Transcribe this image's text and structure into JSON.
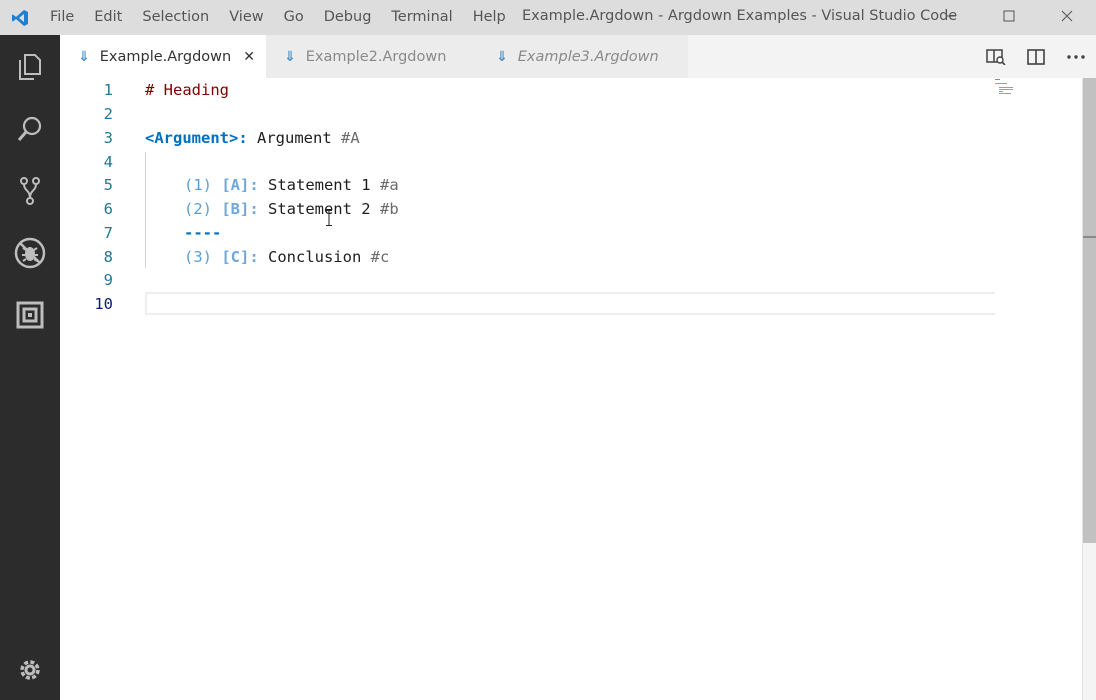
{
  "menu": [
    "File",
    "Edit",
    "Selection",
    "View",
    "Go",
    "Debug",
    "Terminal",
    "Help"
  ],
  "window_title": "Example.Argdown - Argdown Examples - Visual Studio Code",
  "window_controls": [
    "minimize-icon",
    "maximize-icon",
    "close-icon"
  ],
  "activity_bar": [
    "explorer-icon",
    "search-icon",
    "source-control-icon",
    "debug-icon",
    "extensions-icon",
    "settings-gear-icon"
  ],
  "tabs": [
    {
      "label": "Example.Argdown",
      "active": true,
      "close": "✕"
    },
    {
      "label": "Example2.Argdown",
      "active": false
    },
    {
      "label": "Example3.Argdown",
      "active": false,
      "preview": true
    }
  ],
  "tab_actions": [
    "open-preview-icon",
    "split-editor-icon",
    "more-actions-icon"
  ],
  "editor": {
    "line_numbers": [
      "1",
      "2",
      "3",
      "4",
      "5",
      "6",
      "7",
      "8",
      "9",
      "10"
    ],
    "current_line": "10",
    "lines": {
      "l1": {
        "heading": "# Heading"
      },
      "l3": {
        "argument": "<Argument>",
        "colon": ":",
        "title": " Argument ",
        "tag": "#A"
      },
      "l5": {
        "num": "(1) ",
        "ref": "[A]:",
        "text": " Statement 1 ",
        "tag": "#a"
      },
      "l6": {
        "num": "(2) ",
        "ref": "[B]:",
        "text": " Statement 2 ",
        "tag": "#b"
      },
      "l7": {
        "sep": "----"
      },
      "l8": {
        "num": "(3) ",
        "ref": "[C]:",
        "text": " Conclusion ",
        "tag": "#c"
      }
    }
  },
  "colors": {
    "titlebar": "#dddddd",
    "activitybar": "#2c2c2c",
    "line_number": "#237893",
    "argument": "#0070c1",
    "heading": "#800000"
  }
}
